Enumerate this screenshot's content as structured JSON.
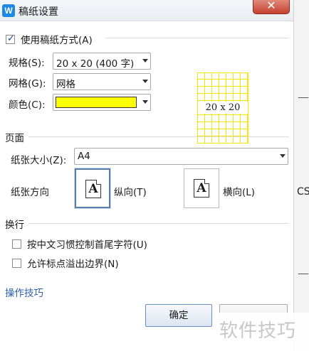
{
  "window": {
    "icon_letter": "W",
    "title": "稿纸设置",
    "close_glyph": "✕"
  },
  "use_grid_paper": {
    "label": "使用稿纸方式(A)",
    "checked": true
  },
  "spec": {
    "label": "规格(S):",
    "value": "20 x 20 (400 字)"
  },
  "grid": {
    "label": "网格(G):",
    "value": "网格"
  },
  "color": {
    "label": "颜色(C):",
    "value": "#ffff00"
  },
  "preview": {
    "text": "20 x 20",
    "grid_color": "#f5e800"
  },
  "page_section": {
    "heading": "页面",
    "paper_size_label": "纸张大小(Z):",
    "paper_size_value": "A4",
    "orientation_label": "纸张方向",
    "portrait_label": "纵向(T)",
    "landscape_label": "横向(L)",
    "orientation_icon_letter": "A",
    "selected_orientation": "portrait"
  },
  "line_break_section": {
    "heading": "换行",
    "option1": {
      "label": "按中文习惯控制首尾字符(U)",
      "checked": false
    },
    "option2": {
      "label": "允许标点溢出边界(N)",
      "checked": false
    }
  },
  "tips_link": "操作技巧",
  "ok_button": "确定",
  "background_text": "CS",
  "watermark": "软件技巧"
}
